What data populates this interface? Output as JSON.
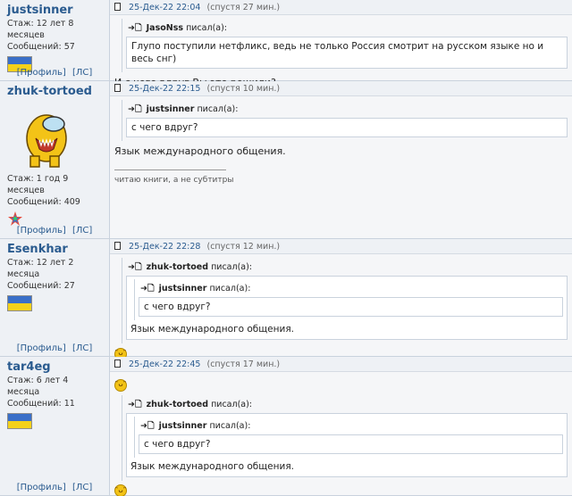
{
  "posts": [
    {
      "author": "justsinner",
      "meta": {
        "tenure": "Стаж: 12 лет 8 месяцев",
        "messages": "Сообщений: 57"
      },
      "header": {
        "date": "25-Дек-22 22:04",
        "elapsed": "(спустя 27 мин.)"
      },
      "quote": {
        "author": "JasoNss",
        "wrote": "писал(а):",
        "text": "Глупо поступили нетфликс, ведь не только Россия смотрит на русском языке но и весь снг)"
      },
      "text": "И с чего вдруг Вы это решили?"
    },
    {
      "author": "zhuk-tortoed",
      "meta": {
        "tenure": "Стаж: 1 год 9 месяцев",
        "messages": "Сообщений: 409"
      },
      "header": {
        "date": "25-Дек-22 22:15",
        "elapsed": "(спустя 10 мин.)"
      },
      "quote": {
        "author": "justsinner",
        "wrote": "писал(а):",
        "text": "с чего вдруг?"
      },
      "text": "Язык международного общения.",
      "signature": "читаю книги, а не субтитры"
    },
    {
      "author": "Esenkhar",
      "meta": {
        "tenure": "Стаж: 12 лет 2 месяца",
        "messages": "Сообщений: 27"
      },
      "header": {
        "date": "25-Дек-22 22:28",
        "elapsed": "(спустя 12 мин.)"
      },
      "quote": {
        "author": "zhuk-tortoed",
        "wrote": "писал(а):",
        "inner": {
          "author": "justsinner",
          "wrote": "писал(а):",
          "text": "с чего вдруг?"
        },
        "text": "Язык международного общения."
      }
    },
    {
      "author": "tar4eg",
      "meta": {
        "tenure": "Стаж: 6 лет 4 месяца",
        "messages": "Сообщений: 11"
      },
      "header": {
        "date": "25-Дек-22 22:45",
        "elapsed": "(спустя 17 мин.)"
      },
      "quote": {
        "author": "zhuk-tortoed",
        "wrote": "писал(а):",
        "inner": {
          "author": "justsinner",
          "wrote": "писал(а):",
          "text": "с чего вдруг?"
        },
        "text": "Язык международного общения."
      }
    }
  ],
  "links": {
    "profile": "[Профиль]",
    "pm": "[ЛС]"
  },
  "icons": {
    "post_link": "document-icon",
    "quote": "quote-arrow-icon",
    "smiley": "laughing-smiley-icon",
    "flag": "ukraine-flag-icon"
  },
  "colors": {
    "link": "#2a5b8f",
    "sidebar_bg": "#eef1f5",
    "flag_blue": "#3a6fc8",
    "flag_yellow": "#f4d11a"
  }
}
